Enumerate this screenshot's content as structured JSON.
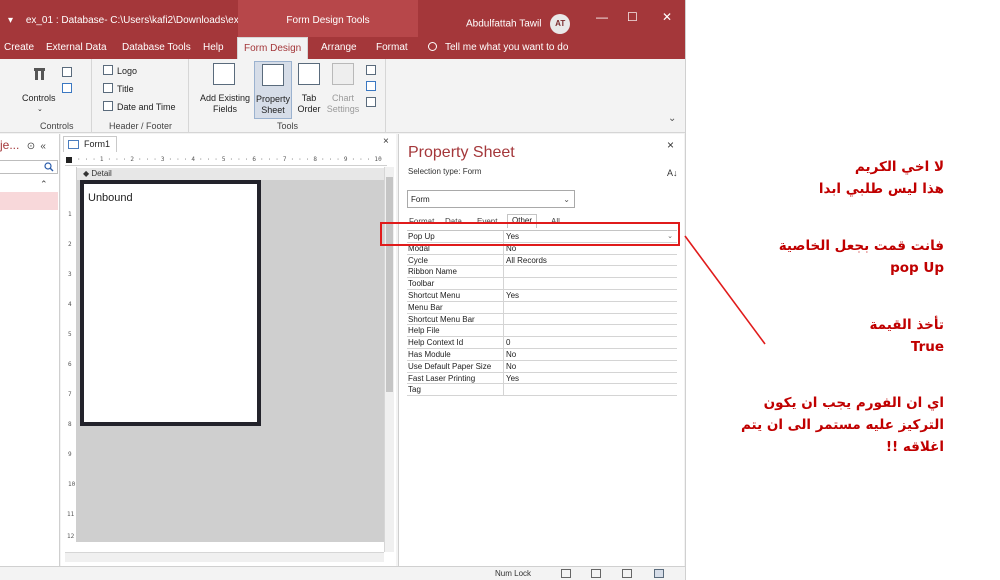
{
  "titlebar": {
    "file_path": "ex_01 : Database- C:\\Users\\kafi2\\Downloads\\ex_...",
    "context_title": "Form Design Tools",
    "user_name": "Abdulfattah Tawil",
    "user_initials": "AT",
    "minimize_glyph": "—",
    "maximize_glyph": "☐",
    "close_glyph": "✕"
  },
  "ribbon_tabs": [
    "Create",
    "External Data",
    "Database Tools",
    "Help",
    "Form Design",
    "Arrange",
    "Format"
  ],
  "active_tab": "Form Design",
  "tell_me": "Tell me what you want to do",
  "ribbon": {
    "controls_label": "Controls",
    "controls_group": "Controls",
    "logo": "Logo",
    "title": "Title",
    "date_time": "Date and Time",
    "header_footer_group": "Header / Footer",
    "add_existing_fields_1": "Add Existing",
    "add_existing_fields_2": "Fields",
    "property_sheet_1": "Property",
    "property_sheet_2": "Sheet",
    "tab_order_1": "Tab",
    "tab_order_2": "Order",
    "chart_settings_1": "Chart",
    "chart_settings_2": "Settings",
    "tools_group": "Tools"
  },
  "nav_pane": {
    "header": "je...",
    "collapse_glyph": "«"
  },
  "document": {
    "tab_name": "Form1",
    "close_glyph": "×",
    "section": "Detail",
    "control_text": "Unbound",
    "ruler_marks": "· · · 1 · · · 2 · · · 3 · · · 4 · · · 5 · · · 6 · · · 7 · · · 8 · · · 9 · · · 10",
    "vertical_marks": [
      "1",
      "2",
      "3",
      "4",
      "5",
      "6",
      "7",
      "8",
      "9",
      "10",
      "11",
      "12"
    ]
  },
  "property_sheet": {
    "title": "Property Sheet",
    "selection_type": "Selection type:  Form",
    "object": "Form",
    "tabs": [
      "Format",
      "Data",
      "Event",
      "Other",
      "All"
    ],
    "active_tab": "Other",
    "properties": [
      {
        "name": "Pop Up",
        "value": "Yes"
      },
      {
        "name": "Modal",
        "value": "No"
      },
      {
        "name": "Cycle",
        "value": "All Records"
      },
      {
        "name": "Ribbon Name",
        "value": ""
      },
      {
        "name": "Toolbar",
        "value": ""
      },
      {
        "name": "Shortcut Menu",
        "value": "Yes"
      },
      {
        "name": "Menu Bar",
        "value": ""
      },
      {
        "name": "Shortcut Menu Bar",
        "value": ""
      },
      {
        "name": "Help File",
        "value": ""
      },
      {
        "name": "Help Context Id",
        "value": "0"
      },
      {
        "name": "Has Module",
        "value": "No"
      },
      {
        "name": "Use Default Paper Size",
        "value": "No"
      },
      {
        "name": "Fast Laser Printing",
        "value": "Yes"
      },
      {
        "name": "Tag",
        "value": ""
      }
    ]
  },
  "statusbar": {
    "num_lock": "Num Lock"
  },
  "notes": {
    "line1": "لا اخي الكريم",
    "line2": "هذا ليس طلبي ابدا",
    "line3": "فانت قمت بجعل الخاصية",
    "line4": "pop Up",
    "line5": "تأخذ القيمة",
    "line6": "True",
    "line7": "اي ان الفورم يجب ان يكون التركيز عليه مستمر الى ان يتم اغلاقه !!"
  },
  "colors": {
    "title_bar": "#a4373a",
    "annotation": "#e01b1b",
    "note_text": "#c00000"
  }
}
